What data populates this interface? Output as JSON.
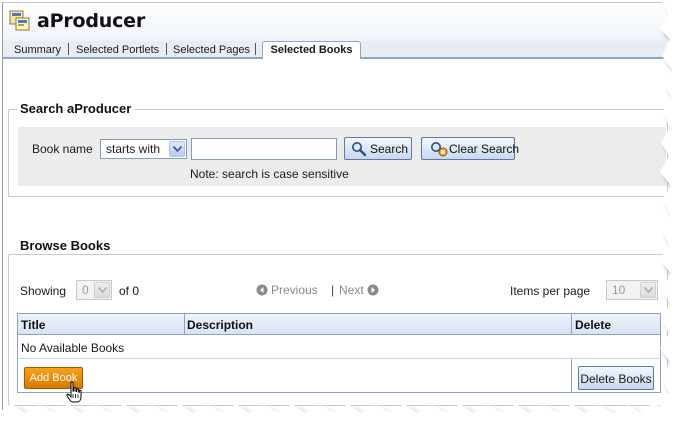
{
  "app": {
    "title": "aProducer",
    "icon": "portlet-producer-icon"
  },
  "tabs": [
    {
      "label": "Summary",
      "selected": false
    },
    {
      "label": "Selected Portlets",
      "selected": false
    },
    {
      "label": "Selected Pages",
      "selected": false
    },
    {
      "label": "Selected Books",
      "selected": true
    }
  ],
  "search": {
    "legend": "Search aProducer",
    "book_name_label": "Book name",
    "match_mode": "starts with",
    "book_name_value": "",
    "search_label": "Search",
    "clear_search_label": "Clear Search",
    "note": "Note: search is case sensitive",
    "search_icon": "magnifier-icon",
    "clear_icon": "clear-search-icon"
  },
  "browse": {
    "legend": "Browse Books",
    "showing_label": "Showing",
    "showing_value": "0",
    "of_label": "of 0",
    "previous_label": "Previous",
    "separator": "|",
    "next_label": "Next",
    "items_per_page_label": "Items per page",
    "items_per_page_value": "10",
    "table": {
      "headers": [
        "Title",
        "Description",
        "Delete"
      ],
      "empty_message": "No Available Books"
    },
    "add_book_label": "Add Book",
    "delete_books_label": "Delete Books"
  },
  "colors": {
    "accent_blue": "#8ea3c6",
    "add_button_orange": "#e88a0c",
    "panel_gray": "#ececec"
  }
}
